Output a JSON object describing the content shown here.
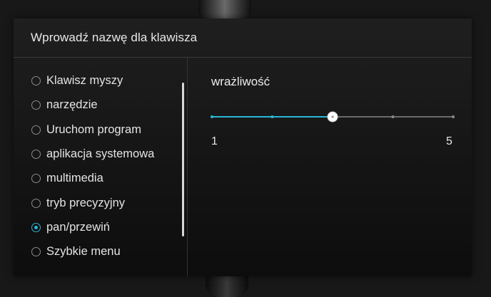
{
  "dialog": {
    "title": "Wprowadź nazwę dla klawisza"
  },
  "options": [
    {
      "label": "Klawisz myszy",
      "selected": false
    },
    {
      "label": "narzędzie",
      "selected": false
    },
    {
      "label": "Uruchom program",
      "selected": false
    },
    {
      "label": "aplikacja systemowa",
      "selected": false
    },
    {
      "label": "multimedia",
      "selected": false
    },
    {
      "label": "tryb precyzyjny",
      "selected": false
    },
    {
      "label": "pan/przewiń",
      "selected": true
    },
    {
      "label": "Szybkie menu",
      "selected": false
    }
  ],
  "sensitivity": {
    "label": "wrażliwość",
    "min_label": "1",
    "max_label": "5",
    "min": 1,
    "max": 5,
    "value": 3,
    "ticks": 5
  },
  "colors": {
    "accent": "#29b6d6",
    "track": "#6a6a6a",
    "background": "#181818"
  }
}
